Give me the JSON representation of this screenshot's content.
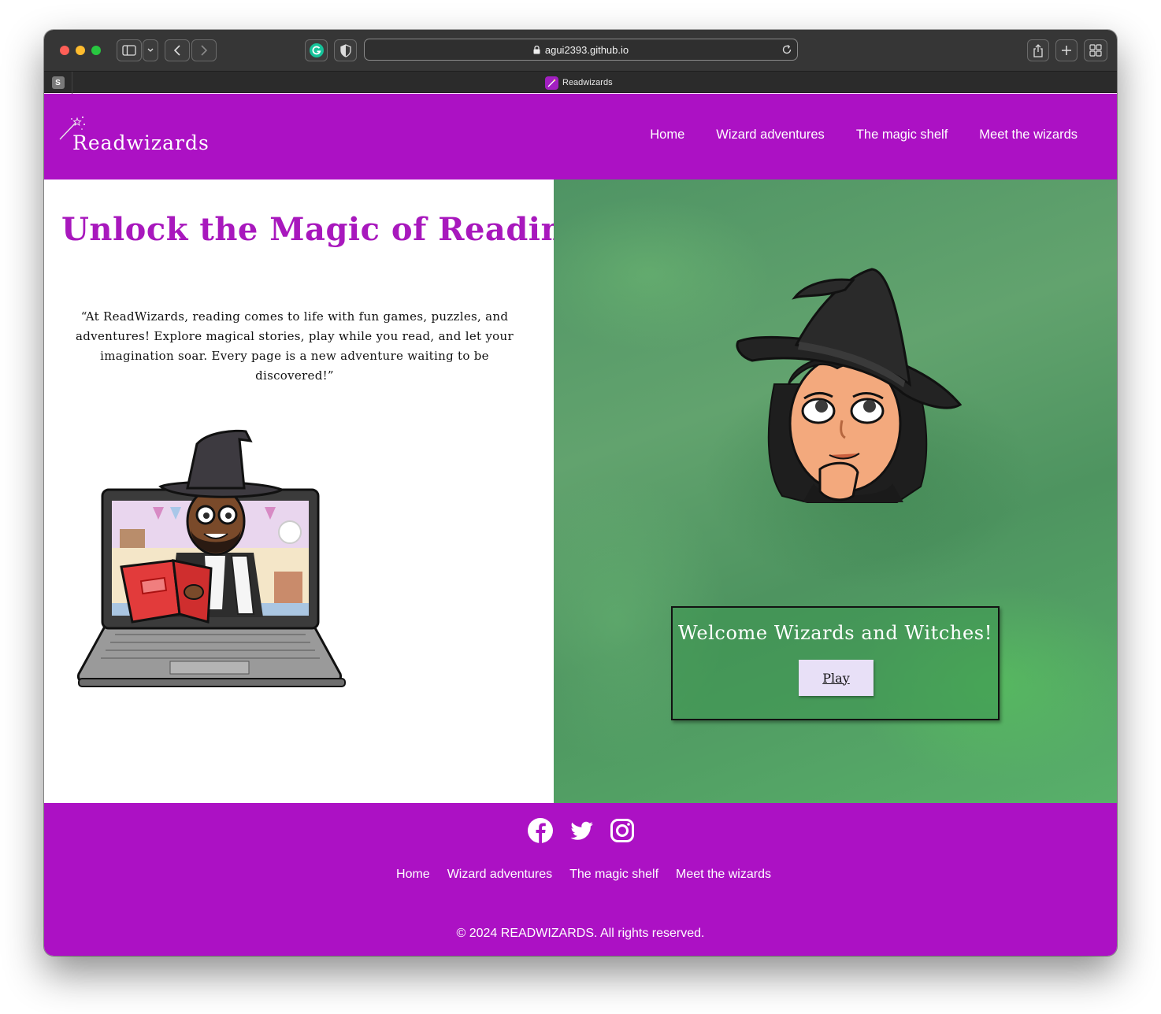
{
  "browser": {
    "url": "agui2393.github.io",
    "tab_title": "Readwizards",
    "pinned_tab_letter": "S"
  },
  "nav": {
    "brand": "Readwizards",
    "links": [
      "Home",
      "Wizard adventures",
      "The magic shelf",
      "Meet the wizards"
    ]
  },
  "hero": {
    "title": "Unlock the Magic of Reading!",
    "quote": "“At ReadWizards, reading comes to life with fun games, puzzles, and adventures! Explore magical stories, play while you read, and let your imagination soar. Every page is a new adventure waiting to be discovered!”"
  },
  "welcome": {
    "title": "Welcome Wizards and Witches!",
    "play_label": "Play"
  },
  "footer": {
    "social_icons": [
      "facebook-icon",
      "twitter-icon",
      "instagram-icon"
    ],
    "links": [
      "Home",
      "Wizard adventures",
      "The magic shelf",
      "Meet the wizards"
    ],
    "copyright": "© 2024 READWIZARDS. All rights reserved."
  },
  "colors": {
    "brand_purple": "#ac11c4",
    "title_purple": "#a818bd",
    "panel_green": "#58a06a",
    "button_lavender": "#e8e0f7"
  }
}
